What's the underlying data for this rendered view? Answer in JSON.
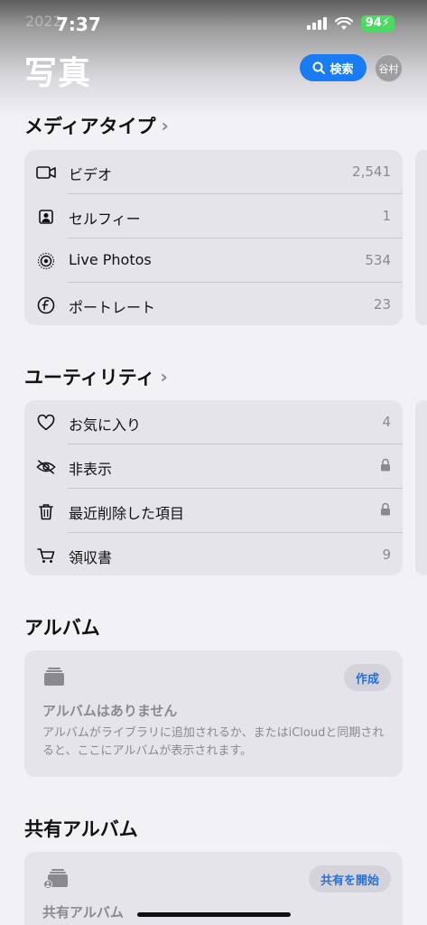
{
  "status_bar": {
    "time": "7:37",
    "battery": "94"
  },
  "peek_text": "2022",
  "header": {
    "title": "写真",
    "search_label": "検索",
    "avatar_initials": "谷村"
  },
  "media_types": {
    "title": "メディアタイプ",
    "items": [
      {
        "label": "ビデオ",
        "count": "2,541",
        "icon": "video-icon"
      },
      {
        "label": "セルフィー",
        "count": "1",
        "icon": "selfie-icon"
      },
      {
        "label": "Live Photos",
        "count": "534",
        "icon": "live-photos-icon"
      },
      {
        "label": "ポートレート",
        "count": "23",
        "icon": "portrait-icon"
      }
    ]
  },
  "utilities": {
    "title": "ユーティリティ",
    "items": [
      {
        "label": "お気に入り",
        "count": "4",
        "icon": "heart-icon"
      },
      {
        "label": "非表示",
        "icon": "hidden-eye-icon",
        "locked": true
      },
      {
        "label": "最近削除した項目",
        "icon": "trash-icon",
        "locked": true
      },
      {
        "label": "領収書",
        "count": "9",
        "icon": "cart-icon"
      }
    ]
  },
  "albums": {
    "title": "アルバム",
    "create_label": "作成",
    "empty_title": "アルバムはありません",
    "empty_desc": "アルバムがライブラリに追加されるか、またはiCloudと同期されると、ここにアルバムが表示されます。"
  },
  "shared_albums": {
    "title": "共有アルバム",
    "start_label": "共有を開始",
    "card_title": "共有アルバム"
  },
  "colors": {
    "accent": "#1a7cf5",
    "card": "#e5e4ea",
    "background": "#f2f1f6",
    "secondary_text": "#8a8a8e"
  }
}
